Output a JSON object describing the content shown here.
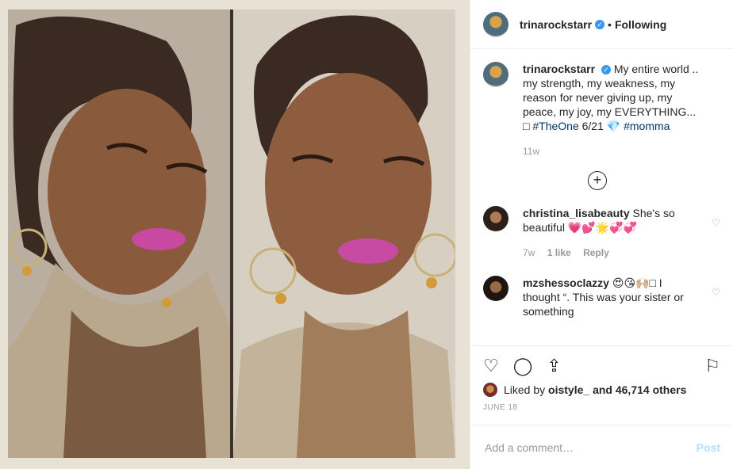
{
  "header": {
    "username": "trinarockstarr",
    "dot": "•",
    "following_label": "Following"
  },
  "caption": {
    "username": "trinarockstarr",
    "text": "My entire world .. my strength, my weakness, my reason for never giving up, my peace, my joy, my EVERYTHING... □",
    "hashtag_1": "#TheOne",
    "date_text": "6/21 💎",
    "hashtag_2": "#momma",
    "age": "11w"
  },
  "load_more_icon": "+",
  "comments": [
    {
      "username": "christina_lisabeauty",
      "text": "She's so beautiful 💗💕🌟💞💞",
      "age": "7w",
      "likes": "1 like",
      "reply": "Reply"
    },
    {
      "username": "mzshessoclazzy",
      "text": "😍😘🙌🏼□ I thought “. This was your sister or something"
    }
  ],
  "likes": {
    "text_prefix": "Liked by",
    "liker": "oistyle_",
    "text_suffix": "and 46,714 others"
  },
  "date": "JUNE 18",
  "add_comment": {
    "placeholder": "Add a comment…",
    "post_label": "Post"
  },
  "icons": [
    "heart-icon",
    "comment-icon",
    "share-icon",
    "bookmark-icon",
    "verified-icon",
    "plus-circle-icon"
  ],
  "colors": {
    "link": "#003569",
    "verified": "#3897f0",
    "post_disabled": "#b2dffc"
  }
}
